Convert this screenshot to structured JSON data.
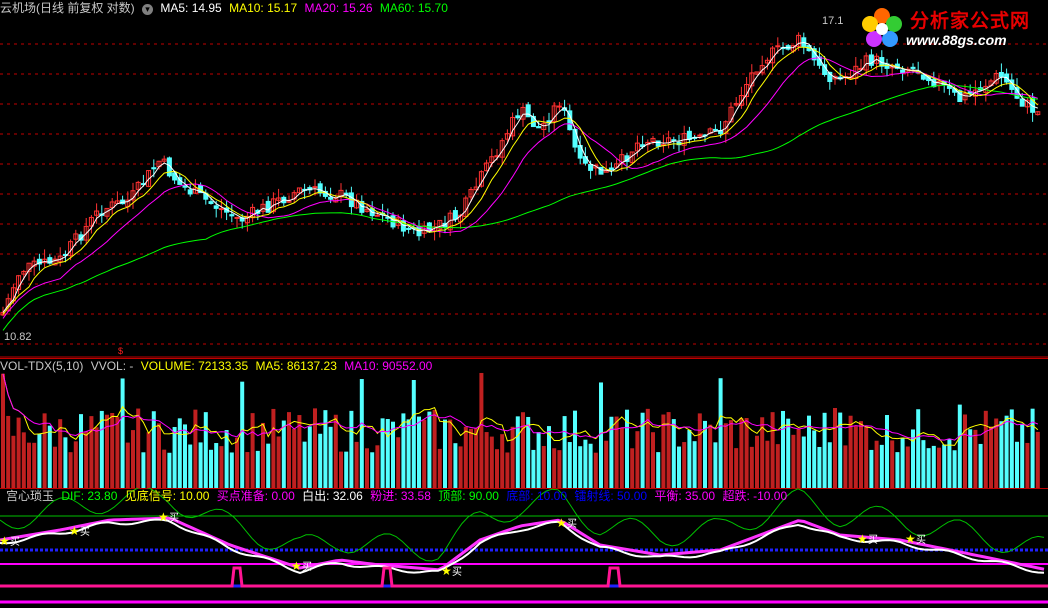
{
  "price_panel": {
    "title": "云机场(日线 前复权 对数)",
    "ma": [
      {
        "label": "MA5: 14.95",
        "color": "#ffffff"
      },
      {
        "label": "MA10: 15.17",
        "color": "#ffff00"
      },
      {
        "label": "MA20: 15.26",
        "color": "#ff00ff"
      },
      {
        "label": "MA60: 15.70",
        "color": "#00ff00"
      }
    ],
    "high_label": "17.1",
    "low_label": "10.82"
  },
  "volume_panel": {
    "title": "VOL-TDX(5,10)",
    "vvol": "VVOL: -",
    "volume": "VOLUME: 72133.35",
    "ma5": "MA5: 86137.23",
    "ma10": "MA10: 90552.00"
  },
  "indicator_panel": {
    "name": "宫心琐玉",
    "items": [
      {
        "label": "DIF: 23.80",
        "color": "#00ff00"
      },
      {
        "label": "见底信号: 10.00",
        "color": "#ffff00"
      },
      {
        "label": "买点准备: 0.00",
        "color": "#ff00ff"
      },
      {
        "label": "白出: 32.06",
        "color": "#ffffff"
      },
      {
        "label": "粉进: 33.58",
        "color": "#ff00ff"
      },
      {
        "label": "顶部: 90.00",
        "color": "#00ff00"
      },
      {
        "label": "底部: 10.00",
        "color": "#0000ff"
      },
      {
        "label": "镭射线: 50.00",
        "color": "#0000ff"
      },
      {
        "label": "平衡: 35.00",
        "color": "#ff00ff"
      },
      {
        "label": "超跌: -10.00",
        "color": "#ff00ff"
      }
    ],
    "buy_label": "买"
  },
  "logo": {
    "text": "分析家公式网",
    "url": "www.88gs.com"
  },
  "colors": {
    "up": "#ff3232",
    "down": "#54ffff",
    "ma60": "#00ff00",
    "grid": "#c00000"
  }
}
